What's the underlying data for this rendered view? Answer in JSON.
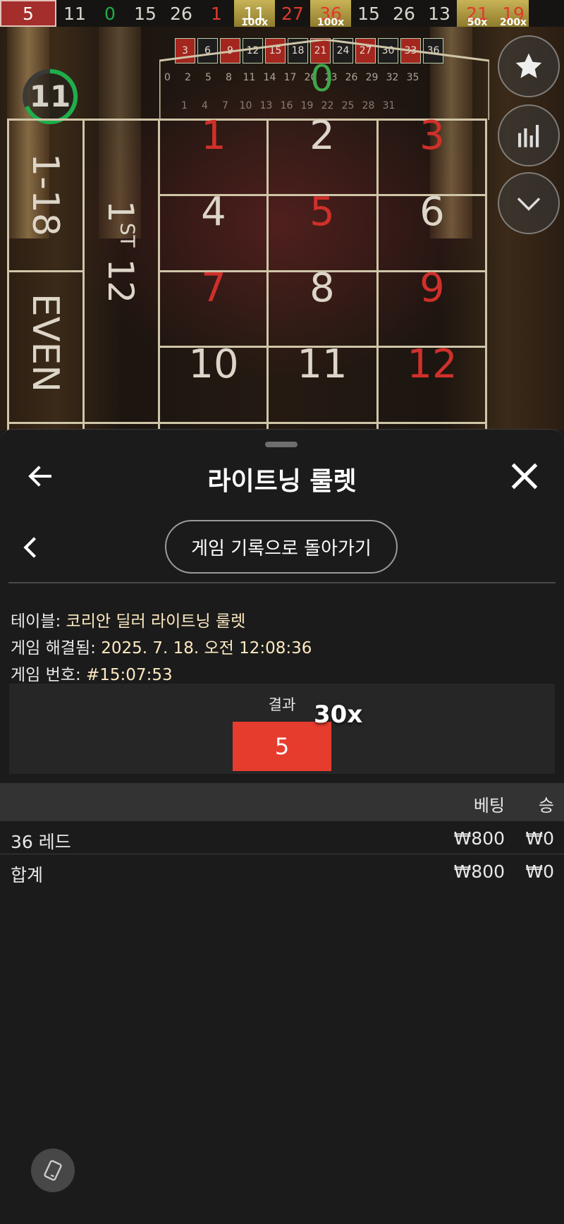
{
  "results_strip": [
    {
      "number": "5",
      "color": "red",
      "current": true
    },
    {
      "number": "11",
      "color": "black"
    },
    {
      "number": "0",
      "color": "green"
    },
    {
      "number": "15",
      "color": "black"
    },
    {
      "number": "26",
      "color": "black"
    },
    {
      "number": "1",
      "color": "red"
    },
    {
      "number": "11",
      "color": "black",
      "multiplier": "100x",
      "lightning": true
    },
    {
      "number": "27",
      "color": "red"
    },
    {
      "number": "36",
      "color": "red",
      "multiplier": "100x",
      "lightning": true
    },
    {
      "number": "15",
      "color": "black"
    },
    {
      "number": "26",
      "color": "black"
    },
    {
      "number": "13",
      "color": "black"
    },
    {
      "number": "21",
      "color": "red",
      "multiplier": "50x",
      "lightning": true
    },
    {
      "number": "19",
      "color": "red",
      "multiplier": "200x",
      "lightning": true
    }
  ],
  "game": {
    "timer": "11",
    "zero": "0",
    "mini_board_top": [
      "3",
      "6",
      "9",
      "12",
      "15",
      "18",
      "21",
      "24",
      "27",
      "30",
      "33",
      "36"
    ],
    "mini_board_mid": [
      "0",
      "2",
      "5",
      "8",
      "11",
      "14",
      "17",
      "20",
      "23",
      "26",
      "29",
      "32",
      "35"
    ],
    "mini_board_bottom": [
      "1",
      "4",
      "7",
      "10",
      "13",
      "16",
      "19",
      "22",
      "25",
      "28",
      "31"
    ],
    "grid": [
      {
        "n": "1",
        "red": true
      },
      {
        "n": "2",
        "red": false
      },
      {
        "n": "3",
        "red": true
      },
      {
        "n": "4",
        "red": false
      },
      {
        "n": "5",
        "red": true
      },
      {
        "n": "6",
        "red": false
      },
      {
        "n": "7",
        "red": true
      },
      {
        "n": "8",
        "red": false
      },
      {
        "n": "9",
        "red": true
      },
      {
        "n": "10",
        "red": false
      },
      {
        "n": "11",
        "red": false
      },
      {
        "n": "12",
        "red": true
      }
    ],
    "outside_low": "1-18",
    "outside_even": "EVEN",
    "dozen_prefix": "1",
    "dozen_suffix": "ST",
    "dozen_number": "12",
    "side_buttons": [
      "star-icon",
      "statistics-icon",
      "chevron-down-icon"
    ]
  },
  "sheet": {
    "title": "라이트닝 룰렛",
    "history_button": "게임 기록으로 돌아가기",
    "info": {
      "table_label": "테이블:",
      "table_value": "코리안 딜러 라이트닝 룰렛",
      "resolved_label": "게임 해결됨:",
      "resolved_value": "2025. 7. 18. 오전 12:08:36",
      "number_label": "게임 번호:",
      "number_value": "#15:07:53"
    },
    "result": {
      "label": "결과",
      "number": "5",
      "multiplier": "30x",
      "color": "#e63c2e"
    },
    "table": {
      "col_bet": "베팅",
      "col_win": "승",
      "rows": [
        {
          "label": "36 레드",
          "bet": "₩800",
          "win": "₩0"
        },
        {
          "label": "합계",
          "bet": "₩800",
          "win": "₩0"
        }
      ]
    }
  },
  "colors": {
    "red": "#d0302a",
    "green": "#1fae4a",
    "gold": "#c8b356",
    "sheet_bg": "#1b1b1b"
  }
}
